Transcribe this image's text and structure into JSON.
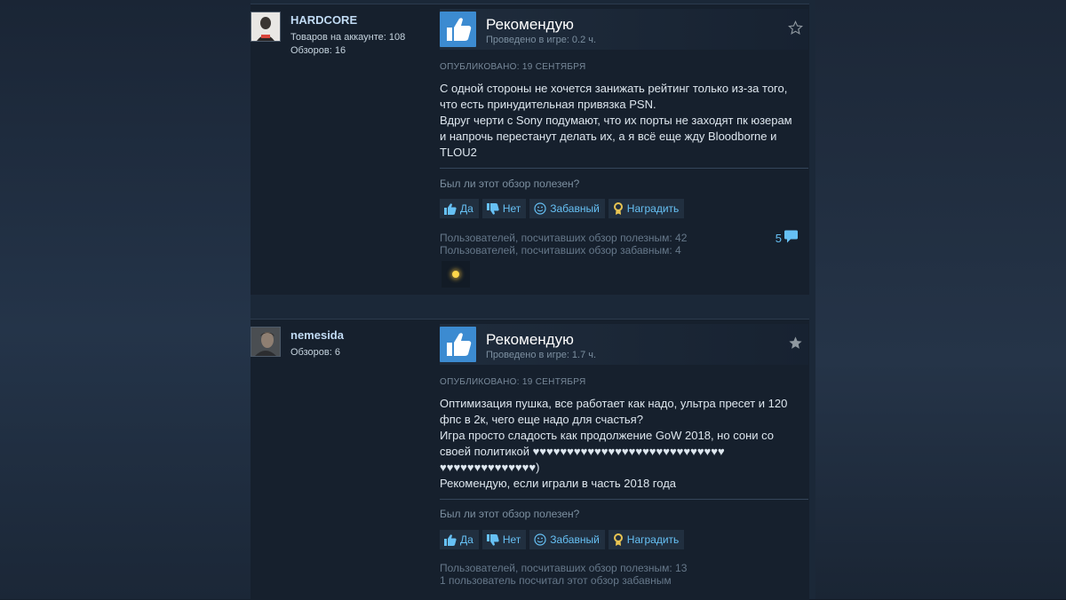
{
  "colors": {
    "accent_link": "#66c0f4",
    "thumb_bg": "#3c8bd1",
    "card_bg": "#16202d",
    "page_bg": "#1b2838"
  },
  "reviews": [
    {
      "author": "HARDCORE",
      "author_lines": [
        "Товаров на аккаунте: 108",
        "Обзоров: 16"
      ],
      "recommendation": "Рекомендую",
      "playtime": "Проведено в игре: 0.2 ч.",
      "posted": "ОПУБЛИКОВАНО: 19 СЕНТЯБРЯ",
      "body": [
        "С одной стороны не хочется занижать рейтинг только из-за того, что есть принудительная привязка PSN.",
        "Вдруг черти с Sony подумают, что их порты не заходят пк юзерам и напрочь перестанут делать их, а я всё еще жду Bloodborne и TLOU2"
      ],
      "helpful_question": "Был ли этот обзор полезен?",
      "buttons": {
        "yes": "Да",
        "no": "Нет",
        "funny": "Забавный",
        "award": "Наградить"
      },
      "stats": [
        "Пользователей, посчитавших обзор полезным: 42",
        "Пользователей, посчитавших обзор забавным: 4"
      ],
      "comment_count": "5",
      "star_icon": "star-outline-icon"
    },
    {
      "author": "nemesida",
      "author_lines": [
        "Обзоров: 6"
      ],
      "recommendation": "Рекомендую",
      "playtime": "Проведено в игре: 1.7 ч.",
      "posted": "ОПУБЛИКОВАНО: 19 СЕНТЯБРЯ",
      "body": [
        "Оптимизация пушка, все работает как надо, ультра пресет и 120 фпс в 2к, чего еще надо для счастья?",
        "Игра просто сладость как продолжение GoW 2018, но сони со своей политикой ♥♥♥♥♥♥♥♥♥♥♥♥♥♥♥♥♥♥♥♥♥♥♥♥♥♥♥♥ ♥♥♥♥♥♥♥♥♥♥♥♥♥♥)",
        "Рекомендую, если играли в часть 2018 года"
      ],
      "helpful_question": "Был ли этот обзор полезен?",
      "buttons": {
        "yes": "Да",
        "no": "Нет",
        "funny": "Забавный",
        "award": "Наградить"
      },
      "stats": [
        "Пользователей, посчитавших обзор полезным: 13",
        "1 пользователь посчитал этот обзор забавным"
      ],
      "star_icon": "star-filled-icon"
    }
  ]
}
